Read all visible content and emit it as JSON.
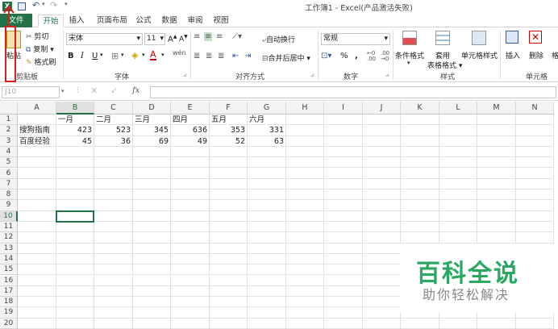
{
  "window": {
    "title": "工作簿1 - Excel(产品激活失败)"
  },
  "tabs": [
    "文件",
    "开始",
    "插入",
    "页面布局",
    "公式",
    "数据",
    "审阅",
    "视图"
  ],
  "ribbon": {
    "clipboard": {
      "paste": "粘贴",
      "cut": "剪切",
      "copy": "复制",
      "format_painter": "格式刷",
      "label": "剪贴板"
    },
    "font": {
      "name": "宋体",
      "size": "11",
      "bold": "B",
      "italic": "I",
      "underline": "U",
      "label": "字体"
    },
    "alignment": {
      "wrap": "自动换行",
      "merge": "合并后居中",
      "label": "对齐方式"
    },
    "number": {
      "format": "常规",
      "percent": "%",
      "comma": ",",
      "label": "数字"
    },
    "styles": {
      "conditional": "条件格式",
      "table_format_1": "套用",
      "table_format_2": "表格格式",
      "cell_styles": "单元格样式",
      "label": "样式"
    },
    "cells": {
      "insert": "插入",
      "delete": "删除",
      "format": "格",
      "label": "单元格"
    }
  },
  "formula_bar": {
    "name_box": "J10",
    "fx": "fx",
    "content": ""
  },
  "columns": [
    "A",
    "B",
    "C",
    "D",
    "E",
    "F",
    "G",
    "H",
    "I",
    "J",
    "K",
    "L",
    "M",
    "N"
  ],
  "rows": [
    "1",
    "2",
    "3",
    "4",
    "5",
    "6",
    "7",
    "8",
    "9",
    "10",
    "11",
    "12",
    "13",
    "14",
    "15",
    "16",
    "17",
    "18",
    "19",
    "20"
  ],
  "sheet": {
    "headers": [
      "一月",
      "二月",
      "三月",
      "四月",
      "五月",
      "六月"
    ],
    "data": [
      {
        "name": "搜狗指南",
        "values": [
          "423",
          "523",
          "345",
          "636",
          "353",
          "331"
        ]
      },
      {
        "name": "百度经验",
        "values": [
          "45",
          "36",
          "69",
          "49",
          "52",
          "63"
        ]
      }
    ]
  },
  "selection": {
    "row": "10",
    "column": "B"
  },
  "watermark": {
    "title": "百科全说",
    "subtitle": "助你轻松解决"
  },
  "colors": {
    "accent": "#217346",
    "annotation": "#d42020",
    "watermark": "#2aa760"
  }
}
